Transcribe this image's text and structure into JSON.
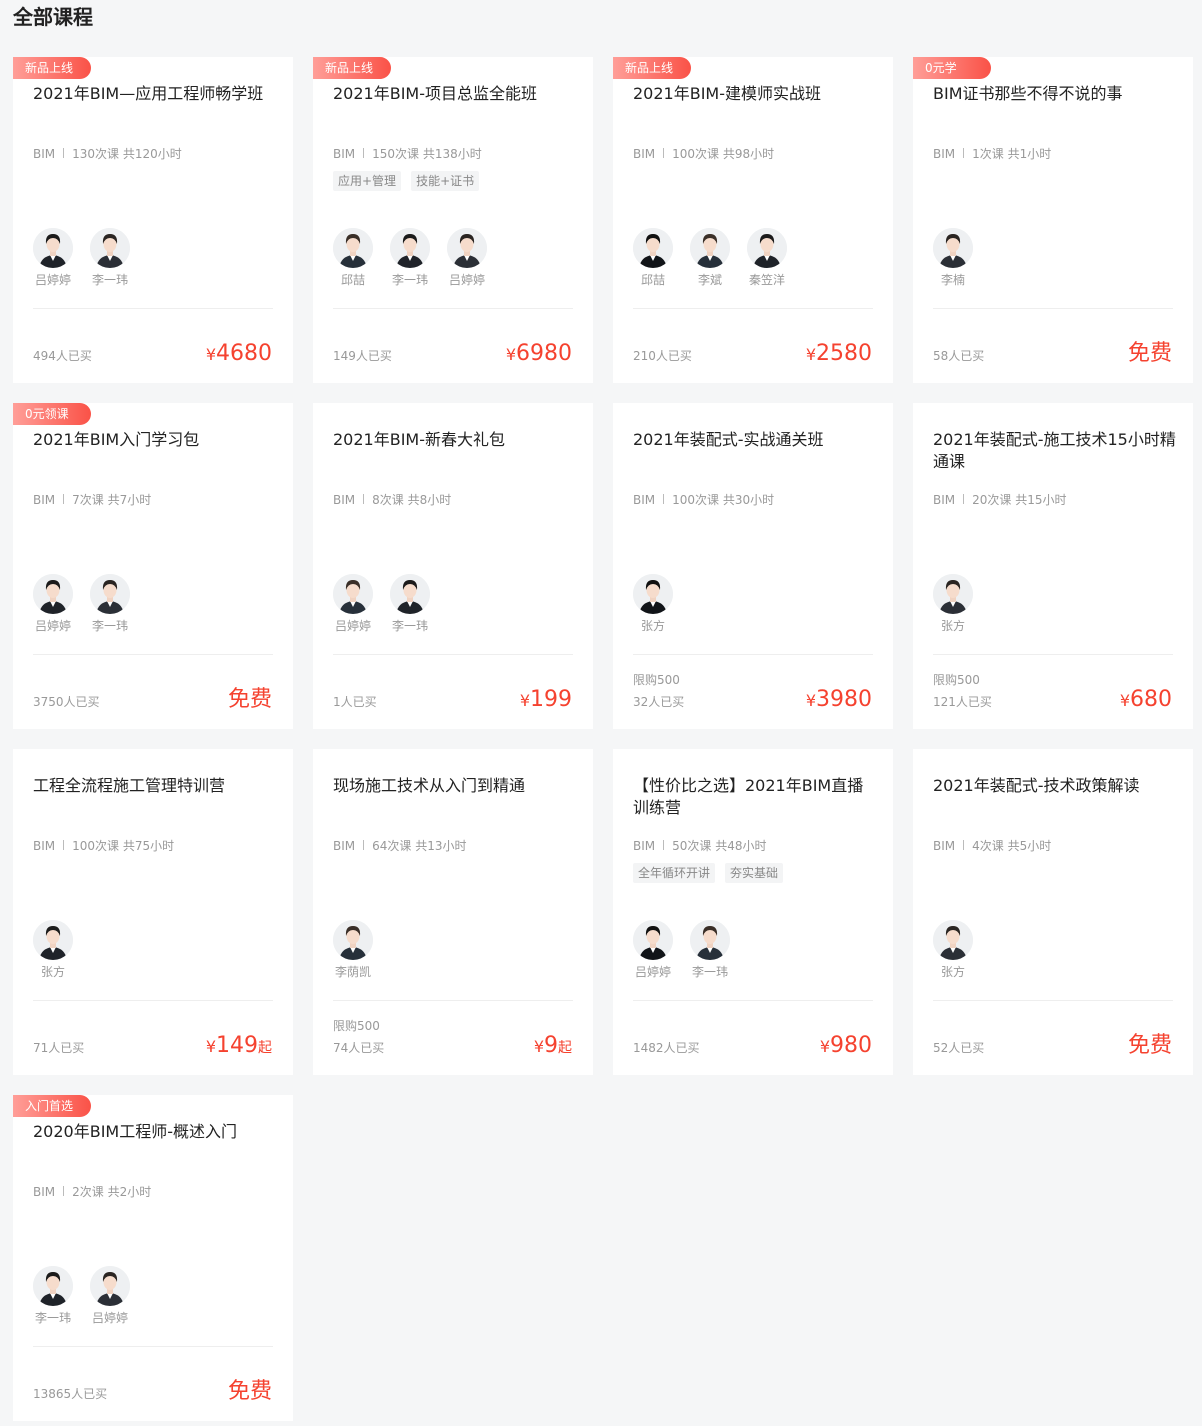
{
  "page": {
    "title": "全部课程"
  },
  "icons": {
    "avatar": "teacher-avatar-icon"
  },
  "colors": {
    "price": "#f5422f",
    "badge_from": "#ff9e98",
    "badge_to": "#fa5247",
    "background": "#f5f6f7"
  },
  "courses": [
    {
      "badge": "新品上线",
      "title": "2021年BIM—应用工程师畅学班",
      "category": "BIM",
      "lessons": "130次课 共120小时",
      "tags": [],
      "teachers": [
        "吕婷婷",
        "李一玮"
      ],
      "limit": "",
      "sold": "494人已买",
      "price_prefix": "¥",
      "price": "4680",
      "price_suffix": ""
    },
    {
      "badge": "新品上线",
      "title": "2021年BIM-项目总监全能班",
      "category": "BIM",
      "lessons": "150次课 共138小时",
      "tags": [
        "应用+管理",
        "技能+证书"
      ],
      "teachers": [
        "邱喆",
        "李一玮",
        "吕婷婷"
      ],
      "limit": "",
      "sold": "149人已买",
      "price_prefix": "¥",
      "price": "6980",
      "price_suffix": ""
    },
    {
      "badge": "新品上线",
      "title": "2021年BIM-建模师实战班",
      "category": "BIM",
      "lessons": "100次课 共98小时",
      "tags": [],
      "teachers": [
        "邱喆",
        "李斌",
        "秦笠洋"
      ],
      "limit": "",
      "sold": "210人已买",
      "price_prefix": "¥",
      "price": "2580",
      "price_suffix": ""
    },
    {
      "badge": "0元学",
      "title": "BIM证书那些不得不说的事",
      "category": "BIM",
      "lessons": "1次课 共1小时",
      "tags": [],
      "teachers": [
        "李楠"
      ],
      "limit": "",
      "sold": "58人已买",
      "price_prefix": "",
      "price": "免费",
      "price_suffix": ""
    },
    {
      "badge": "0元领课",
      "title": "2021年BIM入门学习包",
      "category": "BIM",
      "lessons": "7次课 共7小时",
      "tags": [],
      "teachers": [
        "吕婷婷",
        "李一玮"
      ],
      "limit": "",
      "sold": "3750人已买",
      "price_prefix": "",
      "price": "免费",
      "price_suffix": ""
    },
    {
      "badge": "",
      "title": "2021年BIM-新春大礼包",
      "category": "BIM",
      "lessons": "8次课 共8小时",
      "tags": [],
      "teachers": [
        "吕婷婷",
        "李一玮"
      ],
      "limit": "",
      "sold": "1人已买",
      "price_prefix": "¥",
      "price": "199",
      "price_suffix": ""
    },
    {
      "badge": "",
      "title": "2021年装配式-实战通关班",
      "category": "BIM",
      "lessons": "100次课 共30小时",
      "tags": [],
      "teachers": [
        "张方"
      ],
      "limit": "限购500",
      "sold": "32人已买",
      "price_prefix": "¥",
      "price": "3980",
      "price_suffix": ""
    },
    {
      "badge": "",
      "title": "2021年装配式-施工技术15小时精通课",
      "category": "BIM",
      "lessons": "20次课 共15小时",
      "tags": [],
      "teachers": [
        "张方"
      ],
      "limit": "限购500",
      "sold": "121人已买",
      "price_prefix": "¥",
      "price": "680",
      "price_suffix": ""
    },
    {
      "badge": "",
      "title": "工程全流程施工管理特训营",
      "category": "BIM",
      "lessons": "100次课 共75小时",
      "tags": [],
      "teachers": [
        "张方"
      ],
      "limit": "",
      "sold": "71人已买",
      "price_prefix": "¥",
      "price": "149",
      "price_suffix": "起"
    },
    {
      "badge": "",
      "title": "现场施工技术从入门到精通",
      "category": "BIM",
      "lessons": "64次课 共13小时",
      "tags": [],
      "teachers": [
        "李荫凯"
      ],
      "limit": "限购500",
      "sold": "74人已买",
      "price_prefix": "¥",
      "price": "9",
      "price_suffix": "起"
    },
    {
      "badge": "",
      "title": "【性价比之选】2021年BIM直播训练营",
      "category": "BIM",
      "lessons": "50次课 共48小时",
      "tags": [
        "全年循环开讲",
        "夯实基础"
      ],
      "teachers": [
        "吕婷婷",
        "李一玮"
      ],
      "limit": "",
      "sold": "1482人已买",
      "price_prefix": "¥",
      "price": "980",
      "price_suffix": ""
    },
    {
      "badge": "",
      "title": "2021年装配式-技术政策解读",
      "category": "BIM",
      "lessons": "4次课 共5小时",
      "tags": [],
      "teachers": [
        "张方"
      ],
      "limit": "",
      "sold": "52人已买",
      "price_prefix": "",
      "price": "免费",
      "price_suffix": ""
    },
    {
      "badge": "入门首选",
      "title": "2020年BIM工程师-概述入门",
      "category": "BIM",
      "lessons": "2次课 共2小时",
      "tags": [],
      "teachers": [
        "李一玮",
        "吕婷婷"
      ],
      "limit": "",
      "sold": "13865人已买",
      "price_prefix": "",
      "price": "免费",
      "price_suffix": ""
    }
  ]
}
